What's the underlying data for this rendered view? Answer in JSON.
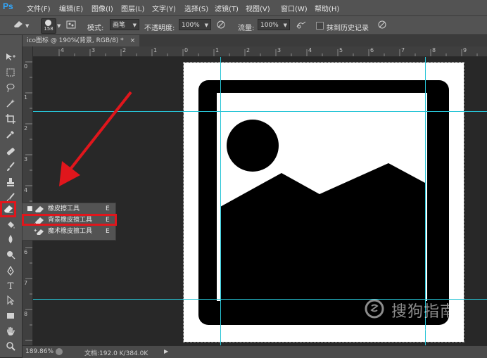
{
  "app": {
    "logo": "Ps"
  },
  "menu": [
    "文件(F)",
    "编辑(E)",
    "图像(I)",
    "图层(L)",
    "文字(Y)",
    "选择(S)",
    "滤镜(T)",
    "视图(V)",
    "窗口(W)",
    "帮助(H)"
  ],
  "options": {
    "brush_size": "158",
    "mode_label": "模式:",
    "mode_value": "画笔",
    "opacity_label": "不透明度:",
    "opacity_value": "100%",
    "flow_label": "流量:",
    "flow_value": "100%",
    "erase_history_label": "抹到历史记录"
  },
  "document_tab": {
    "title": "ico图标 @ 190%(背景, RGB/8) *",
    "close": "×"
  },
  "rulers": {
    "top": [
      "4",
      "3",
      "2",
      "1",
      "0",
      "1",
      "2",
      "3",
      "4",
      "5",
      "6",
      "7",
      "8",
      "9"
    ],
    "left": [
      "0",
      "1",
      "2",
      "3",
      "4",
      "5",
      "6",
      "7",
      "8"
    ]
  },
  "flyout": [
    {
      "label": "橡皮擦工具",
      "key": "E",
      "active": true,
      "icon": "eraser-icon"
    },
    {
      "label": "背景橡皮擦工具",
      "key": "E",
      "active": false,
      "icon": "background-eraser-icon"
    },
    {
      "label": "魔术橡皮擦工具",
      "key": "E",
      "active": false,
      "icon": "magic-eraser-icon"
    }
  ],
  "status": {
    "zoom": "189.86%",
    "doc_info": "文档:192.0 K/384.0K"
  },
  "watermark": {
    "text": "搜狗指南",
    "url": "zhinan.sogou.com"
  },
  "colors": {
    "highlight": "#e0161c",
    "guide": "#27c4d6",
    "ps_blue": "#31a8ff"
  }
}
